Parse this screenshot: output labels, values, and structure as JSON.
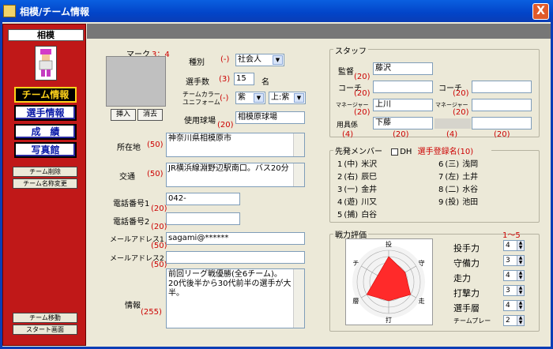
{
  "window": {
    "title": "相模/チーム情報",
    "close": "X"
  },
  "sidebar": {
    "team_name": "相模",
    "nav": [
      {
        "label": "チーム情報",
        "active": true
      },
      {
        "label": "選手情報"
      },
      {
        "label": "成　績"
      },
      {
        "label": "写真館"
      }
    ],
    "actions": [
      "チーム削除",
      "チーム名称変更"
    ],
    "bottom_actions": [
      "チーム移動",
      "スタート画面"
    ]
  },
  "mark": {
    "label": "マーク",
    "size": "3：4",
    "insert": "挿入",
    "delete": "消去"
  },
  "type": {
    "label": "種別",
    "req": "(-)",
    "value": "社会人"
  },
  "players": {
    "label": "選手数",
    "req": "(3)",
    "value": "15",
    "unit": "名"
  },
  "color": {
    "label1": "チームカラー",
    "label2": "ユニフォーム",
    "req": "(-)",
    "value": "紫",
    "value2": "上:紫"
  },
  "stadium": {
    "label": "使用球場",
    "req": "(20)",
    "value": "相模原球場"
  },
  "address": {
    "label": "所在地",
    "req": "(50)",
    "value": "神奈川県相模原市"
  },
  "transport": {
    "label": "交通",
    "req": "(50)",
    "value": "JR横浜線淵野辺駅南口。バス20分"
  },
  "phone1": {
    "label": "電話番号1",
    "req": "(20)",
    "value": "042-"
  },
  "phone2": {
    "label": "電話番号2",
    "req": "(20)",
    "value": ""
  },
  "email1": {
    "label": "メールアドレス1",
    "req": "(50)",
    "value": "sagami@******"
  },
  "email2": {
    "label": "メールアドレス2",
    "req": "(50)",
    "value": ""
  },
  "info": {
    "label": "情報",
    "req": "(255)",
    "value": "前回リーグ戦優勝(全6チーム)。20代後半から30代前半の選手が大半。"
  },
  "staff": {
    "title": "スタッフ",
    "manager": {
      "label": "監督",
      "req": "(20)",
      "value": "藤沢"
    },
    "coach1": {
      "label": "コーチ",
      "req": "(20)",
      "value": ""
    },
    "coach2": {
      "label": "コーチ",
      "req": "(20)",
      "value": ""
    },
    "mgr1": {
      "label": "マネージャー",
      "req": "(20)",
      "value": "上川"
    },
    "mgr2": {
      "label": "マネージャー",
      "req": "(20)",
      "value": ""
    },
    "equip": {
      "label": "用具係",
      "value": "下藤"
    },
    "counts": [
      "(4)",
      "(20)",
      "(4)",
      "(20)"
    ]
  },
  "lineup": {
    "title": "先発メンバー",
    "dh": "DH",
    "reg_label": "選手登録名(10)",
    "left": [
      {
        "no": "1",
        "pos": "(中)",
        "name": "米沢"
      },
      {
        "no": "2",
        "pos": "(右)",
        "name": "辰巳"
      },
      {
        "no": "3",
        "pos": "(一)",
        "name": "金井"
      },
      {
        "no": "4",
        "pos": "(遊)",
        "name": "川又"
      },
      {
        "no": "5",
        "pos": "(捕)",
        "name": "白谷"
      }
    ],
    "right": [
      {
        "no": "6",
        "pos": "(三)",
        "name": "浅岡"
      },
      {
        "no": "7",
        "pos": "(左)",
        "name": "土井"
      },
      {
        "no": "8",
        "pos": "(二)",
        "name": "水谷"
      },
      {
        "no": "9",
        "pos": "(投)",
        "name": "池田"
      }
    ]
  },
  "strength": {
    "title": "戦力評価",
    "range": "1〜5",
    "axes": [
      "投",
      "守",
      "走",
      "打",
      "層",
      "チ"
    ],
    "ratings": [
      {
        "label": "投手力",
        "value": "4"
      },
      {
        "label": "守備力",
        "value": "3"
      },
      {
        "label": "走力",
        "value": "4"
      },
      {
        "label": "打撃力",
        "value": "3"
      },
      {
        "label": "選手層",
        "value": "4"
      },
      {
        "label": "チームプレー",
        "value": "2"
      }
    ],
    "fill_color": "#ff2a2a"
  }
}
